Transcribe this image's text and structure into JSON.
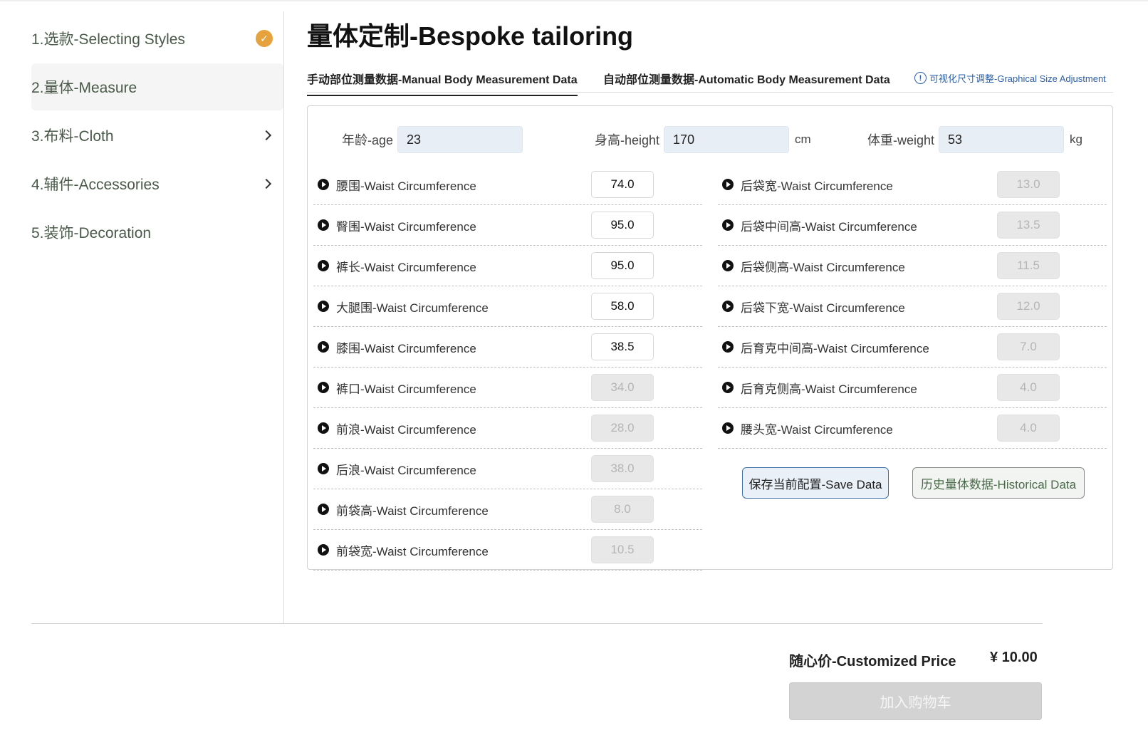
{
  "sidebar": {
    "items": [
      {
        "label": "1.选款-Selecting Styles",
        "status": "done"
      },
      {
        "label": "2.量体-Measure",
        "status": "active"
      },
      {
        "label": "3.布料-Cloth",
        "status": "chevron"
      },
      {
        "label": "4.辅件-Accessories",
        "status": "chevron"
      },
      {
        "label": "5.装饰-Decoration",
        "status": "none"
      }
    ],
    "check_glyph": "✓"
  },
  "main": {
    "title": "量体定制-Bespoke tailoring",
    "tabs": {
      "manual": "手动部位测量数据-Manual Body Measurement Data",
      "automatic": "自动部位测量数据-Automatic Body Measurement Data",
      "graphical": "可视化尺寸调整-Graphical Size Adjustment",
      "info_glyph": "!"
    },
    "basic": {
      "age_label": "年龄-age",
      "age_value": "23",
      "height_label": "身高-height",
      "height_value": "170",
      "height_unit": "cm",
      "weight_label": "体重-weight",
      "weight_value": "53",
      "weight_unit": "kg"
    },
    "left_rows": [
      {
        "label": "腰围-Waist Circumference",
        "value": "74.0",
        "editable": true
      },
      {
        "label": "臀围-Waist Circumference",
        "value": "95.0",
        "editable": true
      },
      {
        "label": "裤长-Waist Circumference",
        "value": "95.0",
        "editable": true
      },
      {
        "label": "大腿围-Waist Circumference",
        "value": "58.0",
        "editable": true
      },
      {
        "label": "膝围-Waist Circumference",
        "value": "38.5",
        "editable": true
      },
      {
        "label": "裤口-Waist Circumference",
        "value": "34.0",
        "editable": false
      },
      {
        "label": "前浪-Waist Circumference",
        "value": "28.0",
        "editable": false
      },
      {
        "label": "后浪-Waist Circumference",
        "value": "38.0",
        "editable": false
      },
      {
        "label": "前袋高-Waist Circumference",
        "value": "8.0",
        "editable": false
      },
      {
        "label": "前袋宽-Waist Circumference",
        "value": "10.5",
        "editable": false
      }
    ],
    "right_rows": [
      {
        "label": "后袋宽-Waist Circumference",
        "value": "13.0",
        "editable": false
      },
      {
        "label": "后袋中间高-Waist Circumference",
        "value": "13.5",
        "editable": false
      },
      {
        "label": "后袋侧高-Waist Circumference",
        "value": "11.5",
        "editable": false
      },
      {
        "label": "后袋下宽-Waist Circumference",
        "value": "12.0",
        "editable": false
      },
      {
        "label": "后育克中间高-Waist Circumference",
        "value": "7.0",
        "editable": false
      },
      {
        "label": "后育克侧高-Waist Circumference",
        "value": "4.0",
        "editable": false
      },
      {
        "label": "腰头宽-Waist Circumference",
        "value": "4.0",
        "editable": false
      }
    ],
    "buttons": {
      "save": "保存当前配置-Save Data",
      "history": "历史量体数据-Historical Data"
    }
  },
  "footer": {
    "price_label": "随心价-Customized Price",
    "price_value": "¥ 10.00",
    "cart_button": "加入购物车"
  },
  "colors": {
    "accent_check": "#e6a23c",
    "link_blue": "#2b5fa8",
    "input_bg": "#e8eef5"
  }
}
